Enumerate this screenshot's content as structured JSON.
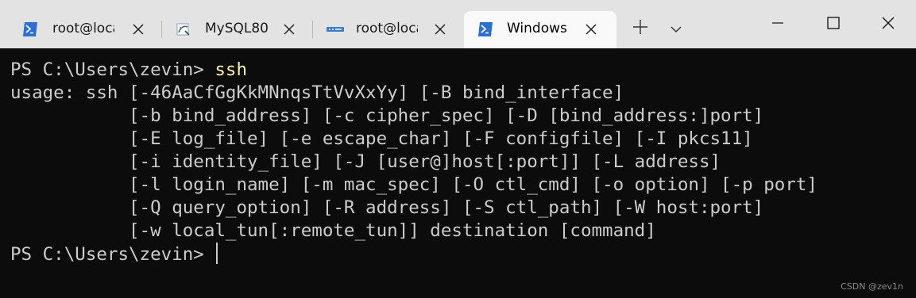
{
  "window": {
    "tabs": [
      {
        "label": "root@loca",
        "icon": "powershell-icon",
        "close": "close-icon"
      },
      {
        "label": "MySQL80",
        "icon": "mysql-icon",
        "close": "close-icon"
      },
      {
        "label": "root@loca",
        "icon": "server-icon",
        "close": "close-icon"
      },
      {
        "label": "Windows",
        "icon": "powershell-icon",
        "close": "close-icon",
        "active": true
      }
    ],
    "new_tab_icon": "plus-icon",
    "dropdown_icon": "chevron-down-icon",
    "controls": [
      "minimize-icon",
      "maximize-icon",
      "close-icon"
    ]
  },
  "terminal": {
    "prompt1": "PS C:\\Users\\zevin> ",
    "command1": "ssh",
    "usage_lines": [
      "usage: ssh [-46AaCfGgKkMNnqsTtVvXxYy] [-B bind_interface]",
      "           [-b bind_address] [-c cipher_spec] [-D [bind_address:]port]",
      "           [-E log_file] [-e escape_char] [-F configfile] [-I pkcs11]",
      "           [-i identity_file] [-J [user@]host[:port]] [-L address]",
      "           [-l login_name] [-m mac_spec] [-O ctl_cmd] [-o option] [-p port]",
      "           [-Q query_option] [-R address] [-S ctl_path] [-W host:port]",
      "           [-w local_tun[:remote_tun]] destination [command]"
    ],
    "prompt2": "PS C:\\Users\\zevin> "
  },
  "watermark": "CSDN @zev1n",
  "colors": {
    "terminal_bg": "#0c0c0c",
    "terminal_fg": "#cccccc",
    "command": "#f9f1a5",
    "tabbar_bg": "#e3e3e3",
    "active_tab_bg": "#f9f9f9",
    "powershell_icon": "#2a6fd6"
  }
}
